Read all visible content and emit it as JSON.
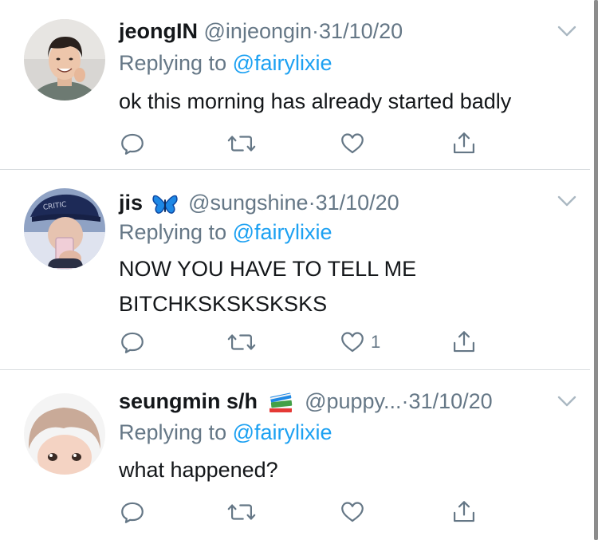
{
  "tweets": [
    {
      "name": "jeongIN",
      "handle": "@injeongin",
      "separator": "·",
      "date": "31/10/20",
      "replying_prefix": "Replying to",
      "replying_handle": "@fairylixie",
      "text": "ok this morning has already started badly",
      "like_count": ""
    },
    {
      "name": "jis",
      "emoji": "butterfly-emoji",
      "handle": "@sungshine",
      "separator": "·",
      "date": "31/10/20",
      "replying_prefix": "Replying to",
      "replying_handle": "@fairylixie",
      "text_lines": [
        "NOW YOU HAVE TO TELL ME",
        "BITCHKSKSKSKSKS"
      ],
      "like_count": "1"
    },
    {
      "name": "seungmin s/h",
      "emoji": "books-emoji",
      "handle": "@puppy...",
      "separator": "·",
      "date": "31/10/20",
      "replying_prefix": "Replying to",
      "replying_handle": "@fairylixie",
      "text": "what happened?",
      "like_count": ""
    }
  ],
  "colors": {
    "link": "#1da1f2",
    "meta": "#657786",
    "text": "#14171a",
    "divider": "#d9dde0"
  }
}
